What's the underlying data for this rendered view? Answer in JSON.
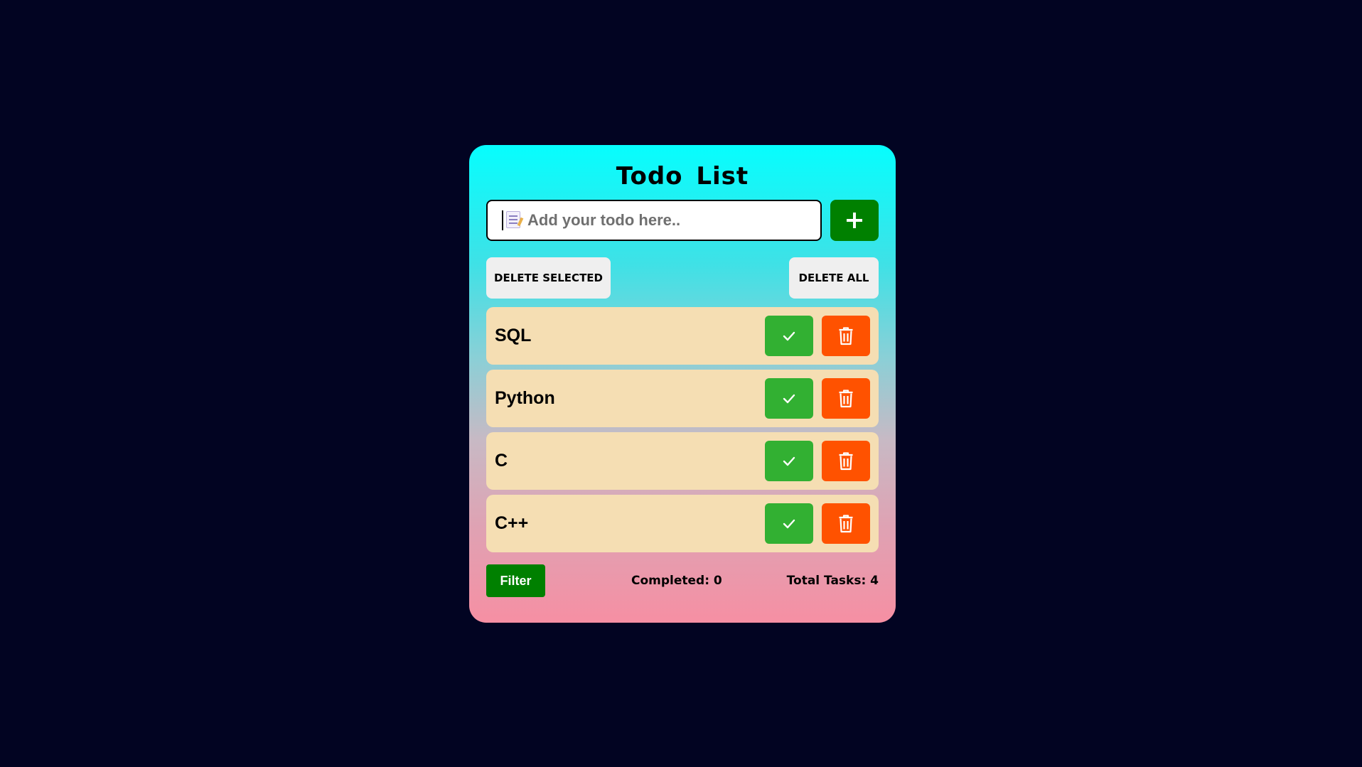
{
  "app": {
    "title": "Todo List"
  },
  "input": {
    "placeholder": "Add your todo here..",
    "value": "",
    "icon": "memo-icon"
  },
  "add_button": {
    "icon": "plus-icon"
  },
  "actions": {
    "delete_selected_label": "DELETE SELECTED",
    "delete_all_label": "DELETE ALL"
  },
  "todos": [
    {
      "text": "SQL",
      "completed": false
    },
    {
      "text": "Python",
      "completed": false
    },
    {
      "text": "C",
      "completed": false
    },
    {
      "text": "C++",
      "completed": false
    }
  ],
  "footer": {
    "filter_label": "Filter",
    "completed_text": "Completed: 0",
    "total_text": "Total Tasks: 4"
  },
  "colors": {
    "page_background": "#020422",
    "gradient_top": "#06fefe",
    "gradient_bottom": "#f68fa3",
    "item_background": "#f5deb3",
    "complete_button": "#32b032",
    "delete_button": "#ff5200",
    "primary_green": "#008000"
  }
}
